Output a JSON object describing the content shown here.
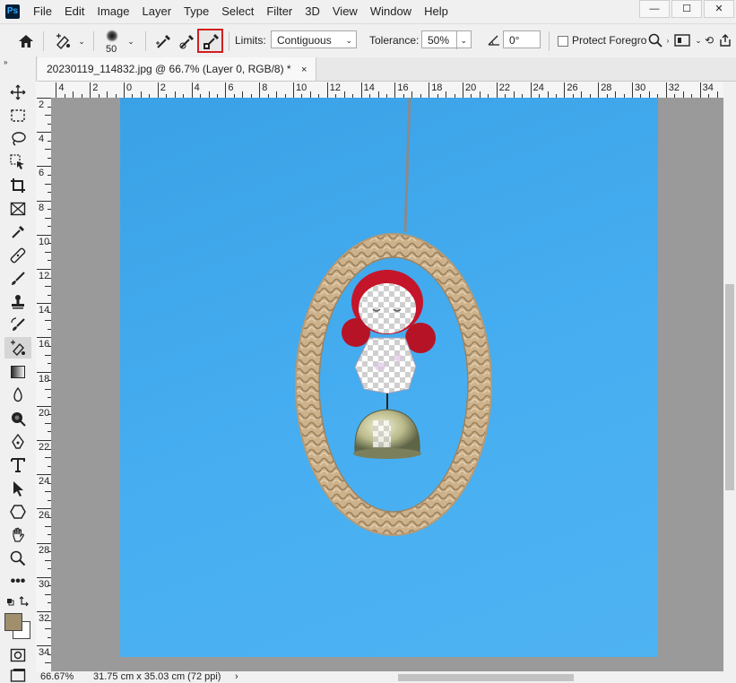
{
  "menubar": {
    "logo": "Ps",
    "items": [
      "File",
      "Edit",
      "Image",
      "Layer",
      "Type",
      "Select",
      "Filter",
      "3D",
      "View",
      "Window",
      "Help"
    ],
    "min": "—",
    "max": "☐",
    "close": "✕"
  },
  "options": {
    "brush_size": "50",
    "limits_label": "Limits:",
    "limits_value": "Contiguous",
    "tolerance_label": "Tolerance:",
    "tolerance_value": "50%",
    "angle_value": "0°",
    "protect_label": "Protect Foregro"
  },
  "tab": {
    "title": "20230119_114832.jpg @ 66.7% (Layer 0, RGB/8) *",
    "close": "×"
  },
  "ruler": {
    "h_labels": [
      "4",
      "2",
      "0",
      "2",
      "4",
      "6",
      "8",
      "10",
      "12",
      "14",
      "16",
      "18",
      "20",
      "22",
      "24",
      "26",
      "28",
      "30",
      "32",
      "34"
    ],
    "v_labels": [
      "2",
      "4",
      "6",
      "8",
      "10",
      "12",
      "14",
      "16",
      "18",
      "20",
      "22",
      "24",
      "26",
      "28",
      "30",
      "32",
      "34"
    ]
  },
  "status": {
    "zoom": "66.67%",
    "size": "31.75 cm x 35.03 cm (72 ppi)",
    "arrow": "›"
  },
  "colors": {
    "accent_red": "#d11f1f",
    "foreground": "#a08e6c",
    "canvas_blue": "#43aaee"
  }
}
